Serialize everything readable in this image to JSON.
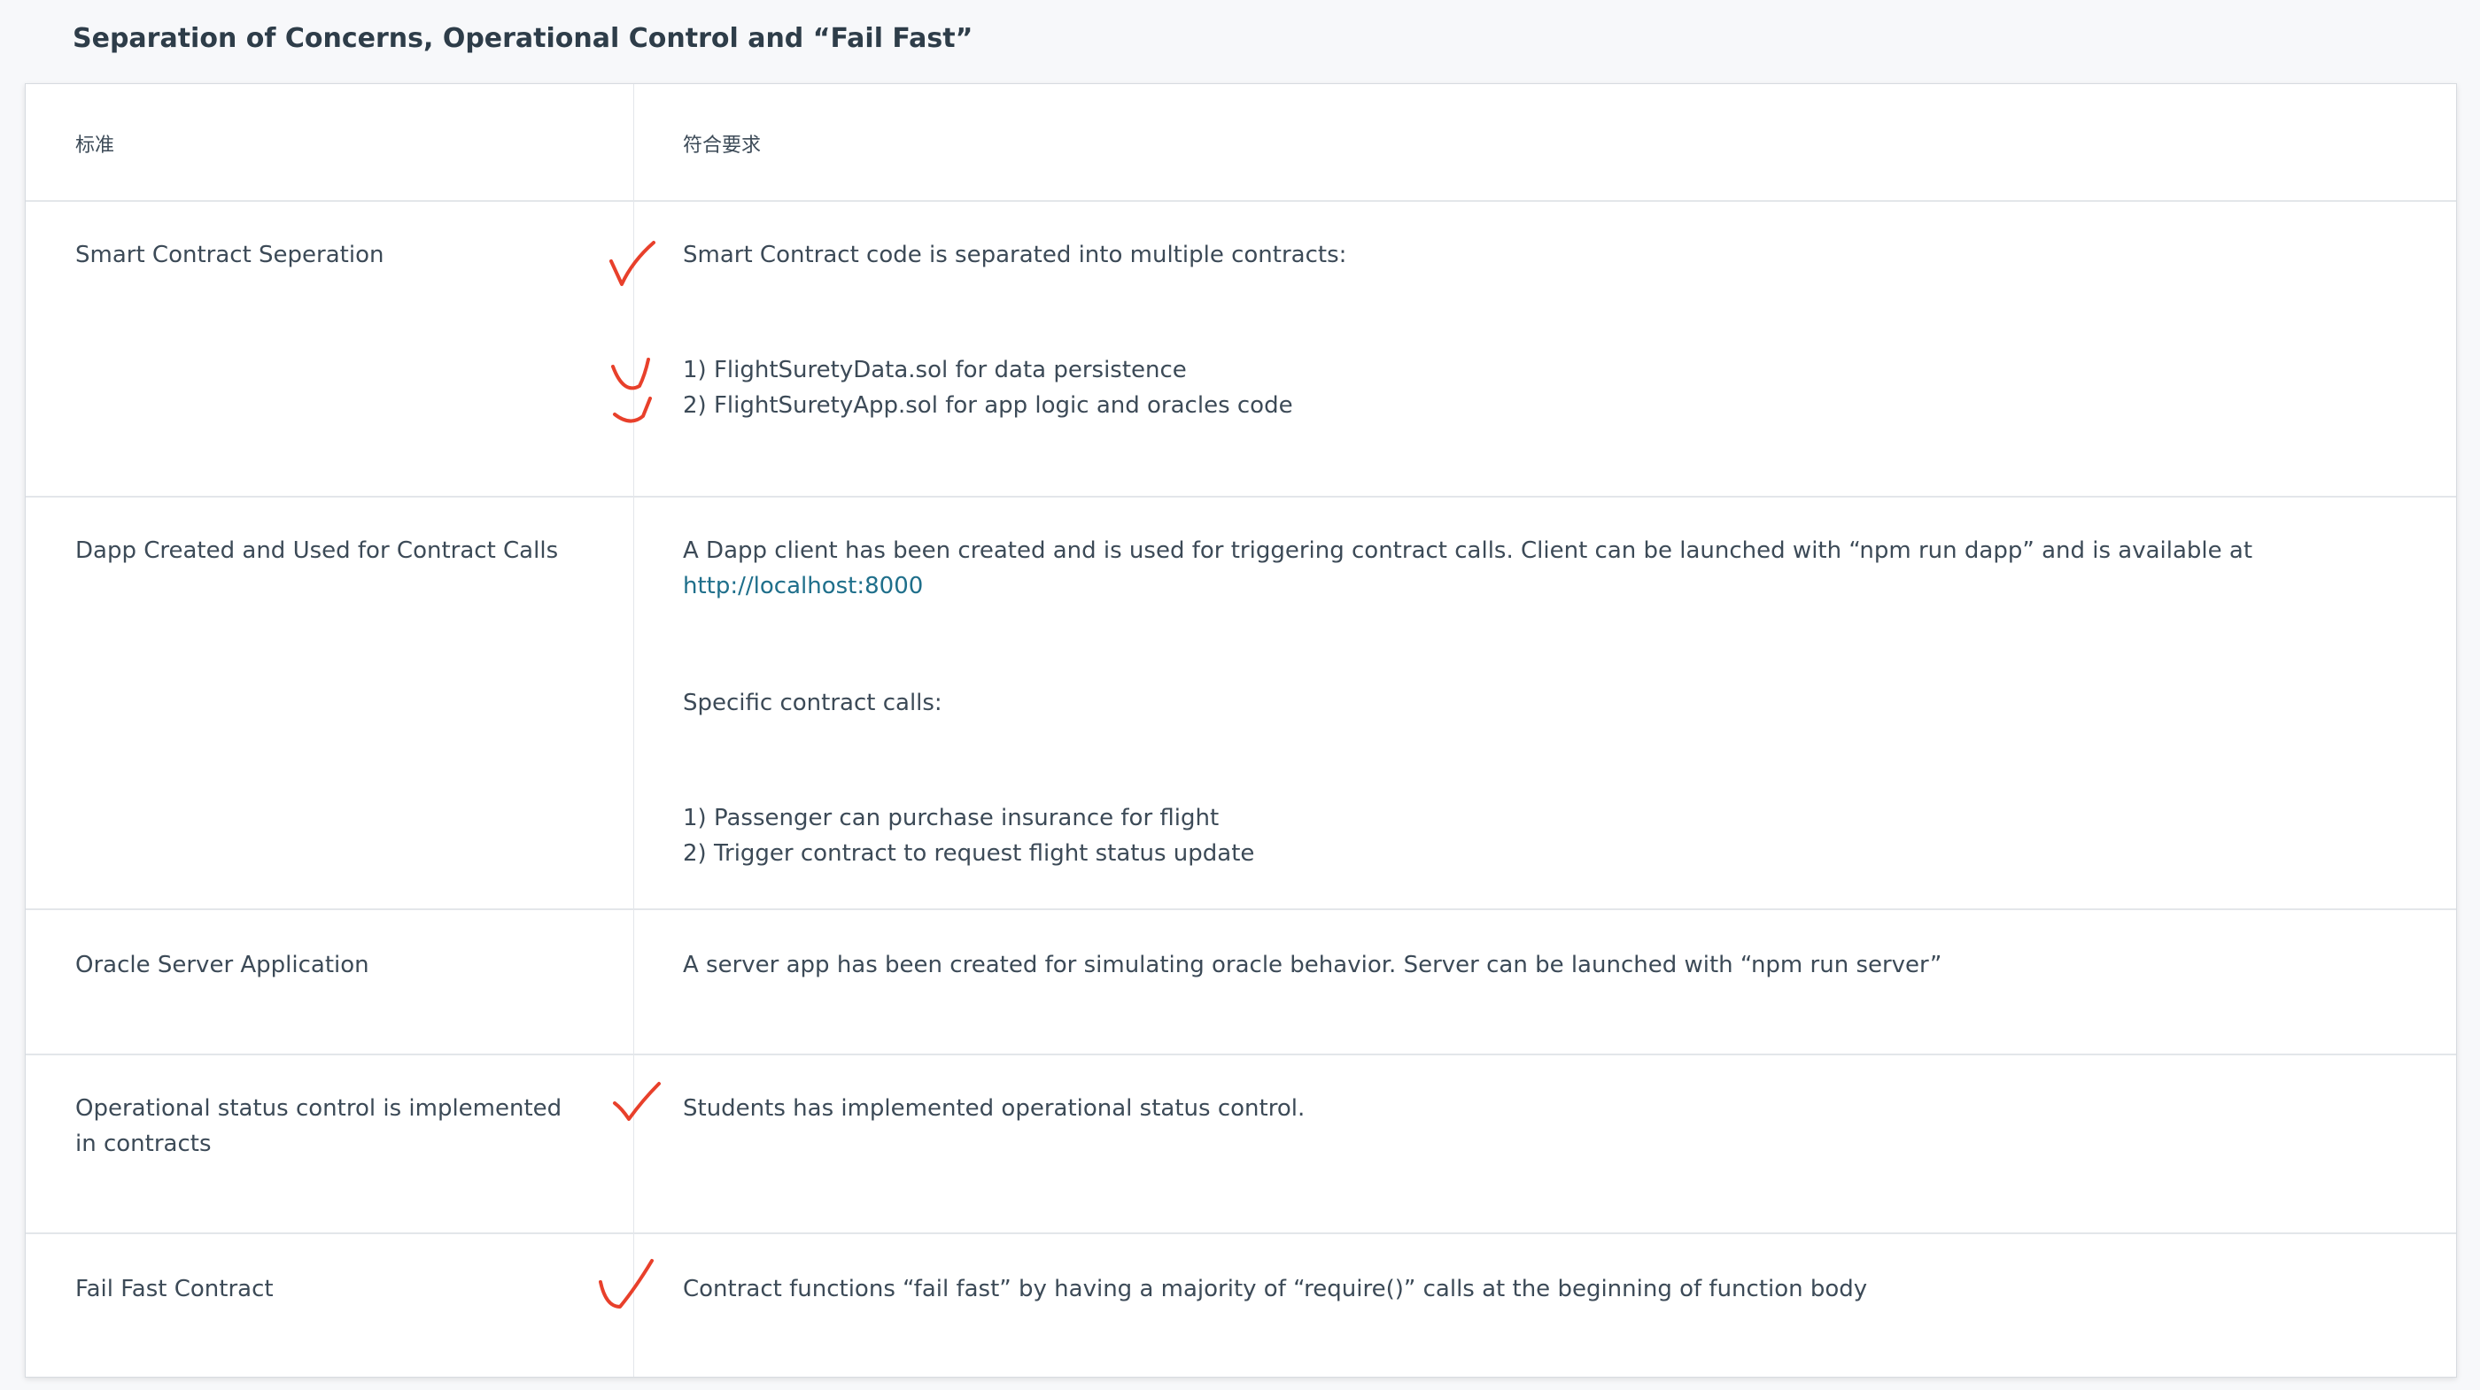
{
  "page": {
    "title": "Separation of Concerns, Operational Control and “Fail Fast”"
  },
  "table": {
    "headers": {
      "criteria": "标准",
      "specification": "符合要求"
    },
    "rows": [
      {
        "criteria": "Smart Contract Seperation",
        "lines": [
          "Smart Contract code is separated into multiple contracts:",
          "1) FlightSuretyData.sol for data persistence",
          "2) FlightSuretyApp.sol for app logic and oracles code"
        ]
      },
      {
        "criteria": "Dapp Created and Used for Contract Calls",
        "lines": [
          "A Dapp client has been created and is used for triggering contract calls. Client can be launched with “npm run dapp” and is available at ",
          "Specific contract calls:",
          "1) Passenger can purchase insurance for flight",
          "2) Trigger contract to request flight status update"
        ],
        "link": "http://localhost:8000"
      },
      {
        "criteria": "Oracle Server Application",
        "lines": [
          "A server app has been created for simulating oracle behavior. Server can be launched with “npm run server”"
        ]
      },
      {
        "criteria": "Operational status control is implemented in contracts",
        "lines": [
          "Students has implemented operational status control."
        ]
      },
      {
        "criteria": "Fail Fast Contract",
        "lines": [
          "Contract functions “fail fast” by having a majority of “require()” calls at the beginning of function body"
        ]
      }
    ]
  },
  "annotations": {
    "mark_color": "#e8402b",
    "mark_icon": "handwritten-checkmark"
  }
}
